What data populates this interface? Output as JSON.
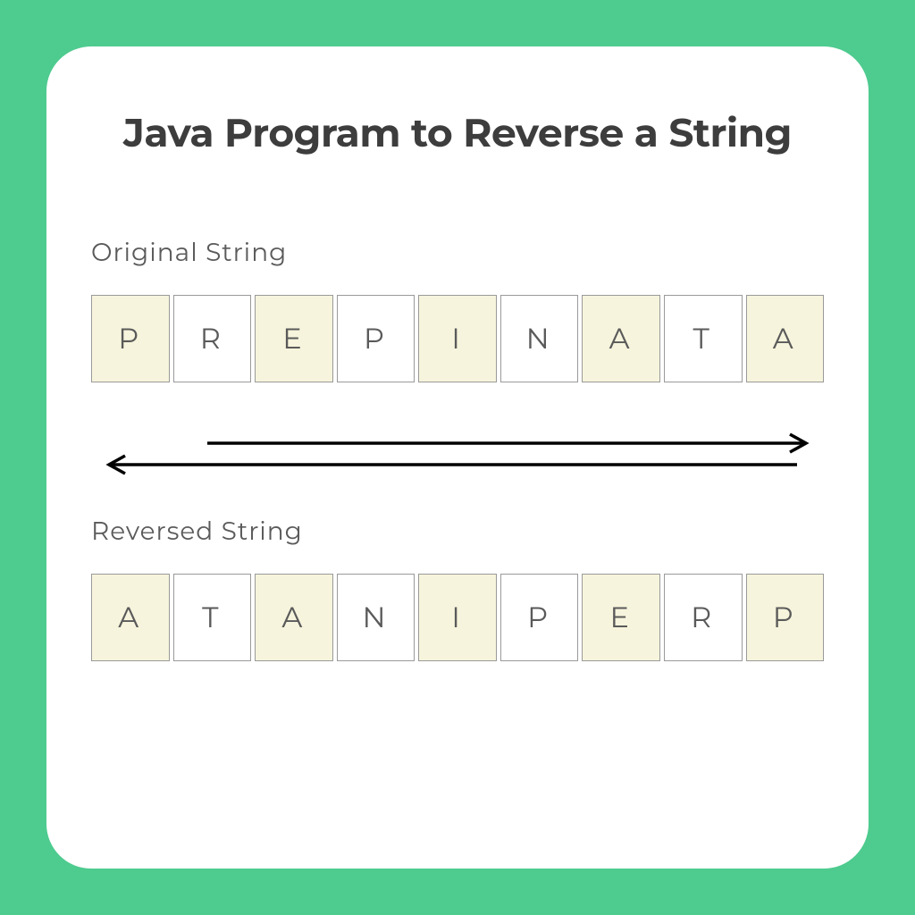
{
  "title": "Java Program to Reverse a String",
  "labels": {
    "original": "Original String",
    "reversed": "Reversed String"
  },
  "original": [
    "P",
    "R",
    "E",
    "P",
    "I",
    "N",
    "A",
    "T",
    "A"
  ],
  "reversed": [
    "A",
    "T",
    "A",
    "N",
    "I",
    "P",
    "E",
    "R",
    "P"
  ],
  "colors": {
    "accent": "#4ecb8f",
    "cellShaded": "#f6f4dc",
    "cellBorder": "#9a9a9a",
    "text": "#3d3d3d"
  }
}
